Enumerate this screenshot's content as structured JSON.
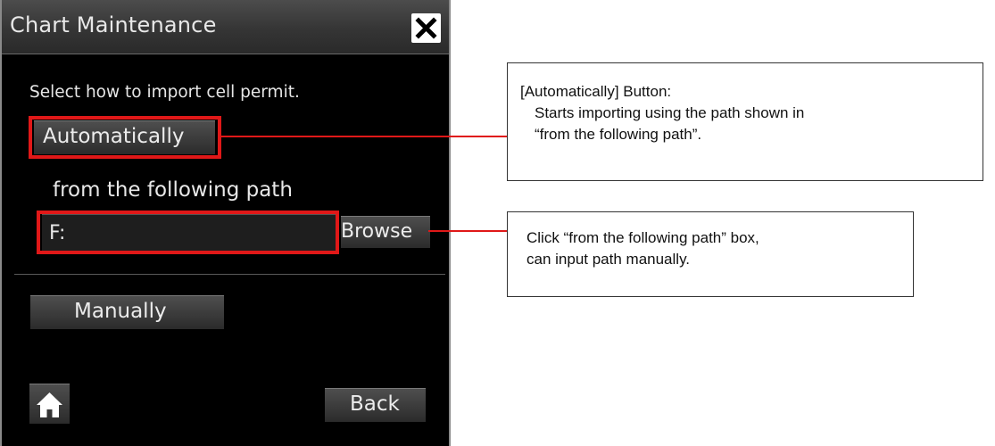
{
  "dialog": {
    "title": "Chart Maintenance",
    "instruction": "Select how to import cell permit.",
    "automatically_label": "Automatically",
    "path_label": "from the following path",
    "path_value": "F:",
    "browse_label": "Browse",
    "manually_label": "Manually",
    "back_label": "Back",
    "close_icon": "close-icon",
    "home_icon": "home-icon"
  },
  "callouts": {
    "automatically": {
      "line1": "[Automatically] Button:",
      "line2": "Starts importing using the path shown in",
      "line3": "“from the following path”."
    },
    "path": {
      "line1": "Click “from the following path” box,",
      "line2": "can input path manually."
    }
  },
  "colors": {
    "highlight": "#e01818",
    "dialog_background": "#000000",
    "button_text": "#ececec"
  }
}
